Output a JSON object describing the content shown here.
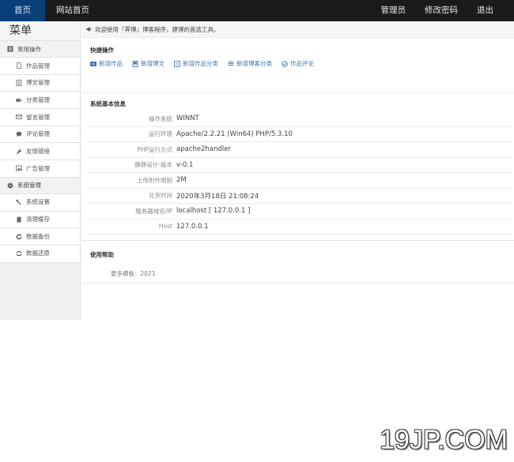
{
  "topbar": {
    "left": [
      {
        "label": "首页",
        "active": true
      },
      {
        "label": "网站首页",
        "active": false
      }
    ],
    "right": [
      {
        "label": "管理员"
      },
      {
        "label": "修改密码"
      },
      {
        "label": "退出"
      }
    ],
    "bg_color": "#1b1b1b",
    "active_color": "#0b3f7a"
  },
  "sidebar": {
    "title": "菜单",
    "groups": [
      {
        "label": "常用操作",
        "icon": "list-icon",
        "items": [
          {
            "label": "作品管理",
            "icon": "file-icon"
          },
          {
            "label": "博文管理",
            "icon": "document-icon"
          },
          {
            "label": "分类管理",
            "icon": "tags-icon"
          },
          {
            "label": "留言管理",
            "icon": "envelope-icon"
          },
          {
            "label": "评论管理",
            "icon": "comment-icon"
          },
          {
            "label": "友情链接",
            "icon": "pushpin-icon"
          },
          {
            "label": "广告管理",
            "icon": "picture-icon"
          }
        ]
      },
      {
        "label": "系统管理",
        "icon": "gear-icon",
        "items": [
          {
            "label": "系统设置",
            "icon": "wrench-icon"
          },
          {
            "label": "清理缓存",
            "icon": "trash-icon"
          },
          {
            "label": "数据备份",
            "icon": "refresh-icon"
          },
          {
            "label": "数据还原",
            "icon": "retweet-icon"
          }
        ]
      }
    ]
  },
  "notice": {
    "icon": "volume-icon",
    "text": "欢迎使用『霁博』博客程序，建博的首选工具。"
  },
  "quick_actions": {
    "title": "快捷操作",
    "links": [
      {
        "label": "新增作品",
        "icon": "film-icon"
      },
      {
        "label": "新增博文",
        "icon": "book-icon"
      },
      {
        "label": "新增作品分类",
        "icon": "list-alt-icon"
      },
      {
        "label": "新增博客分类",
        "icon": "align-justify-icon"
      },
      {
        "label": "作品评论",
        "icon": "ok-circle-icon"
      }
    ],
    "link_color": "#3a75b8"
  },
  "system_info": {
    "title": "系统基本信息",
    "rows": [
      {
        "label": "操作系统",
        "value": "WINNT"
      },
      {
        "label": "运行环境",
        "value": "Apache/2.2.21 (Win64) PHP/5.3.10"
      },
      {
        "label": "PHP运行方式",
        "value": "apache2handler"
      },
      {
        "label": "静静设计-版本",
        "value": "v-0.1"
      },
      {
        "label": "上传附件限制",
        "value": "2M"
      },
      {
        "label": "北京时间",
        "value": "2020年3月18日 21:08:24"
      },
      {
        "label": "服务器域名/IP",
        "value": "localhost [ 127.0.0.1 ]"
      },
      {
        "label": "Host",
        "value": "127.0.0.1"
      }
    ]
  },
  "help": {
    "title": "使用帮助",
    "text": "更多模板：2021"
  },
  "watermark": "19JP.COM"
}
